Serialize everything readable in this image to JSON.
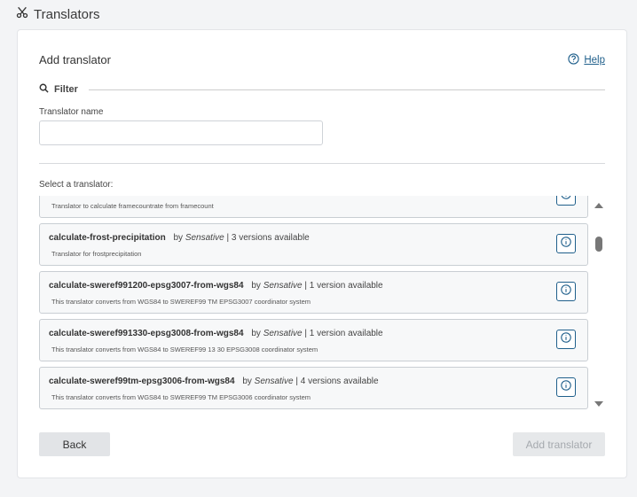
{
  "header": {
    "title": "Translators",
    "icon": "scissors-icon"
  },
  "card": {
    "title": "Add translator",
    "help_label": "Help"
  },
  "filter": {
    "label": "Filter",
    "translator_name_label": "Translator name",
    "translator_name_value": "",
    "translator_name_placeholder": ""
  },
  "select_label": "Select a translator:",
  "translators": [
    {
      "name": "",
      "by_prefix": "",
      "author": "",
      "versions": "",
      "description": "Translator to calculate framecountrate from framecount"
    },
    {
      "name": "calculate-frost-precipitation",
      "by_prefix": "by",
      "author": "Sensative",
      "versions": "| 3 versions available",
      "description": "Translator for frostprecipitation"
    },
    {
      "name": "calculate-sweref991200-epsg3007-from-wgs84",
      "by_prefix": "by",
      "author": "Sensative",
      "versions": "| 1 version available",
      "description": "This translator converts from WGS84 to SWEREF99 TM EPSG3007 coordinator system"
    },
    {
      "name": "calculate-sweref991330-epsg3008-from-wgs84",
      "by_prefix": "by",
      "author": "Sensative",
      "versions": "| 1 version available",
      "description": "This translator converts from WGS84 to SWEREF99 13 30 EPSG3008 coordinator system"
    },
    {
      "name": "calculate-sweref99tm-epsg3006-from-wgs84",
      "by_prefix": "by",
      "author": "Sensative",
      "versions": "| 4 versions available",
      "description": "This translator converts from WGS84 to SWEREF99 TM EPSG3006 coordinator system"
    },
    {
      "name": "",
      "by_prefix": "",
      "author": "",
      "versions": "",
      "description": ""
    }
  ],
  "buttons": {
    "back": "Back",
    "add": "Add translator"
  },
  "colors": {
    "accent": "#1f5f8b",
    "disabled_text": "#a5a9ae",
    "item_border": "#c9ced3"
  }
}
